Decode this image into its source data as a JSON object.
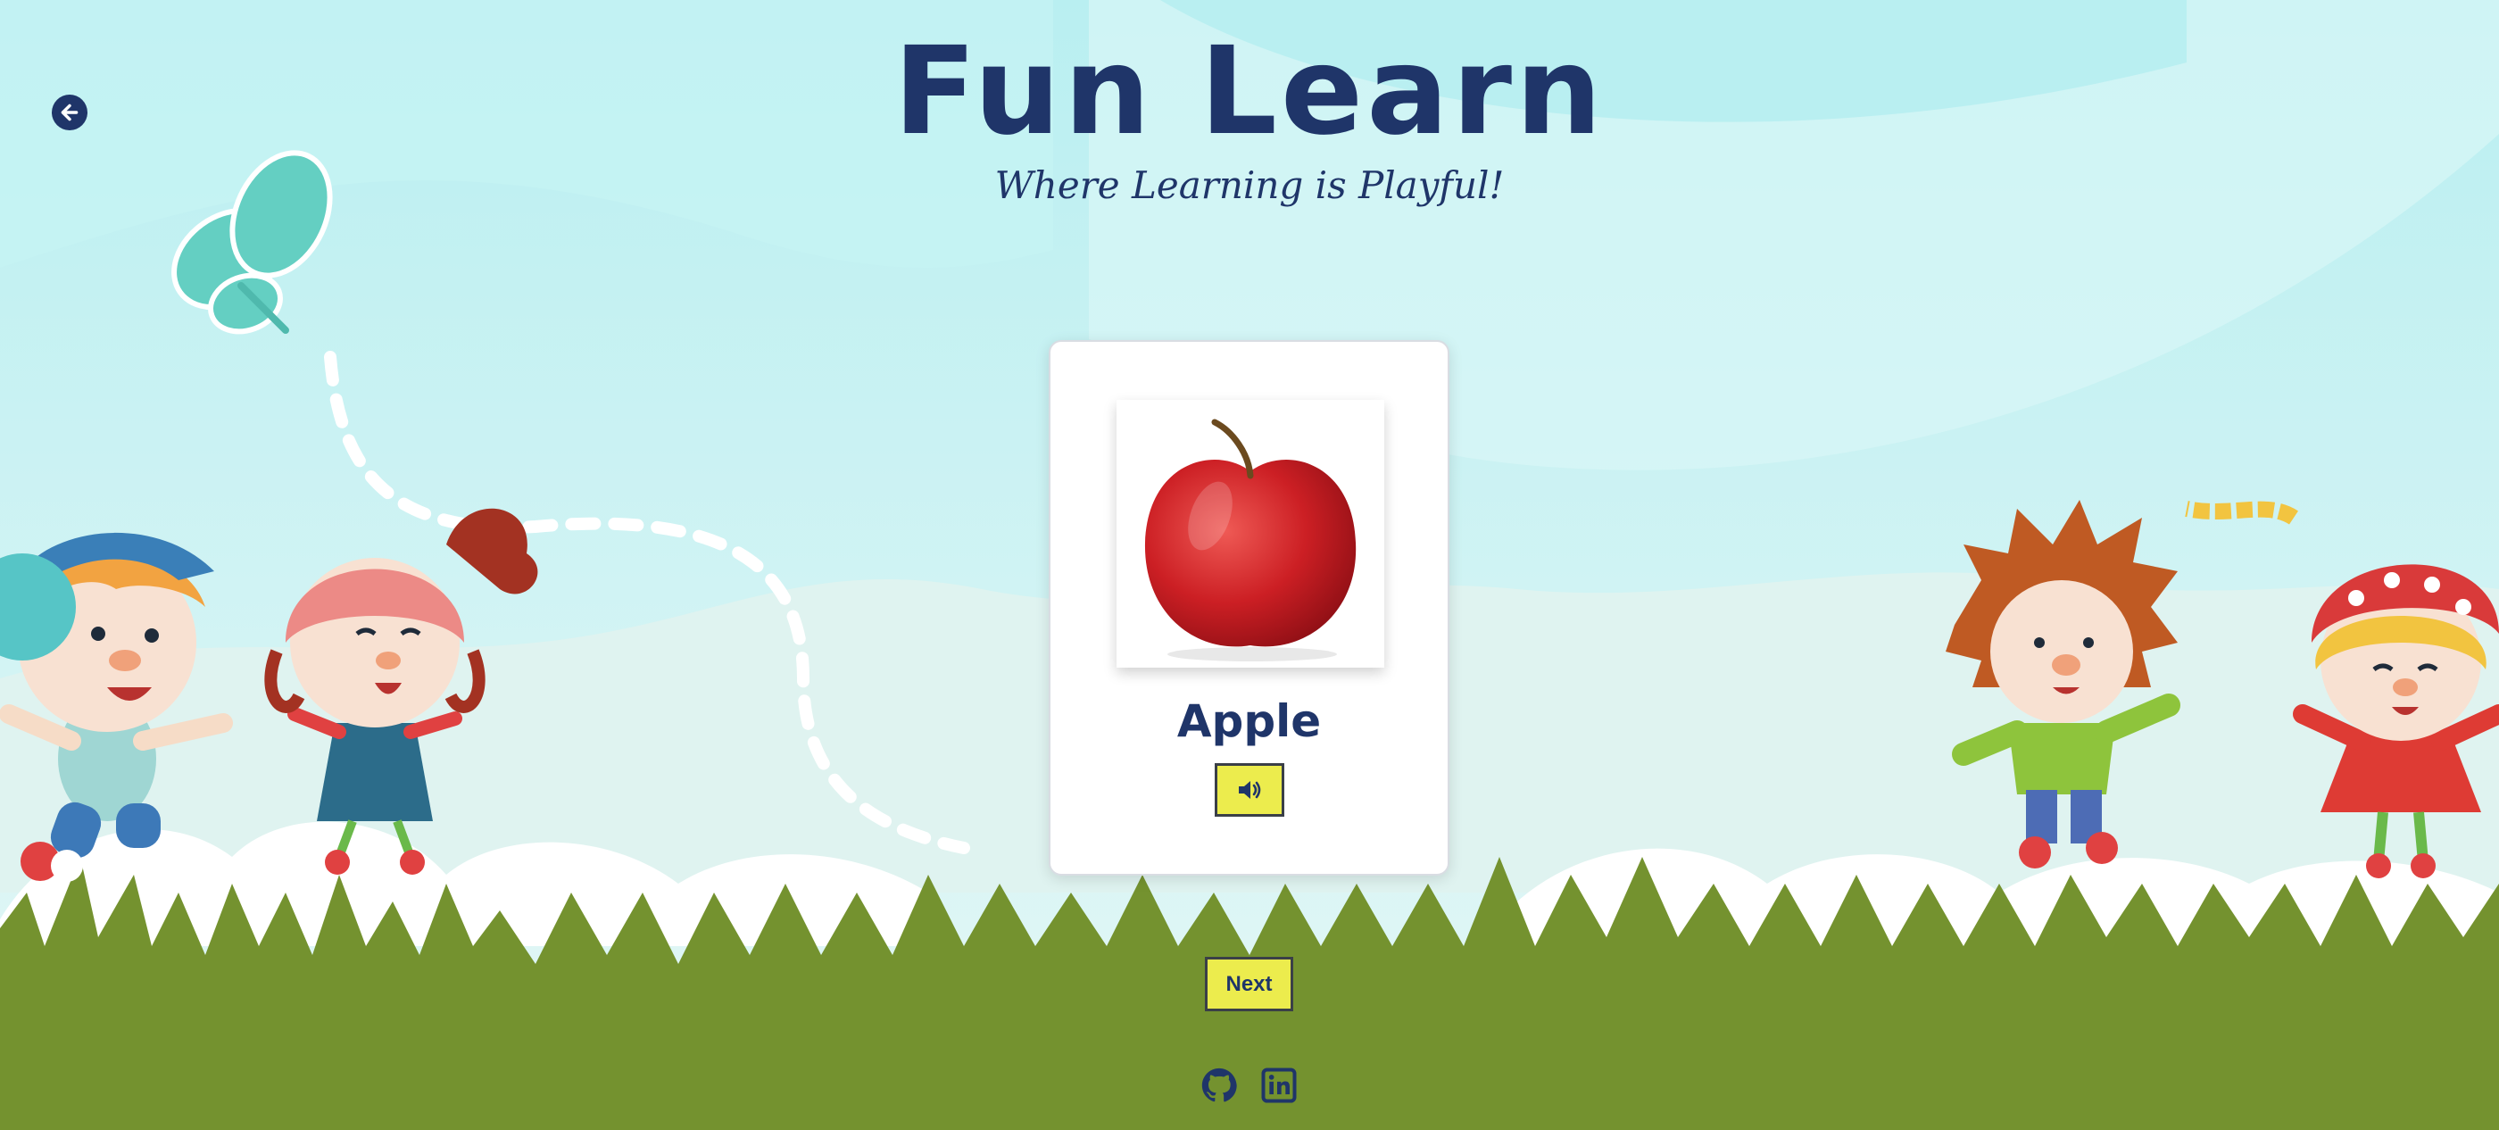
{
  "header": {
    "title": "Fun Learn",
    "subtitle": "Where Learning is Playful!"
  },
  "navigation": {
    "back_icon": "arrow-left-circle-icon"
  },
  "card": {
    "image_icon": "red-apple-photo",
    "word": "Apple",
    "speak_icon": "volume-up-icon"
  },
  "controls": {
    "next_label": "Next"
  },
  "footer": {
    "links": [
      {
        "icon": "github-icon"
      },
      {
        "icon": "linkedin-icon"
      }
    ]
  },
  "colors": {
    "primary_text": "#1f3569",
    "button_yellow": "#ecec4d",
    "grass": "#74922f",
    "sky": "#c9f2f3"
  }
}
